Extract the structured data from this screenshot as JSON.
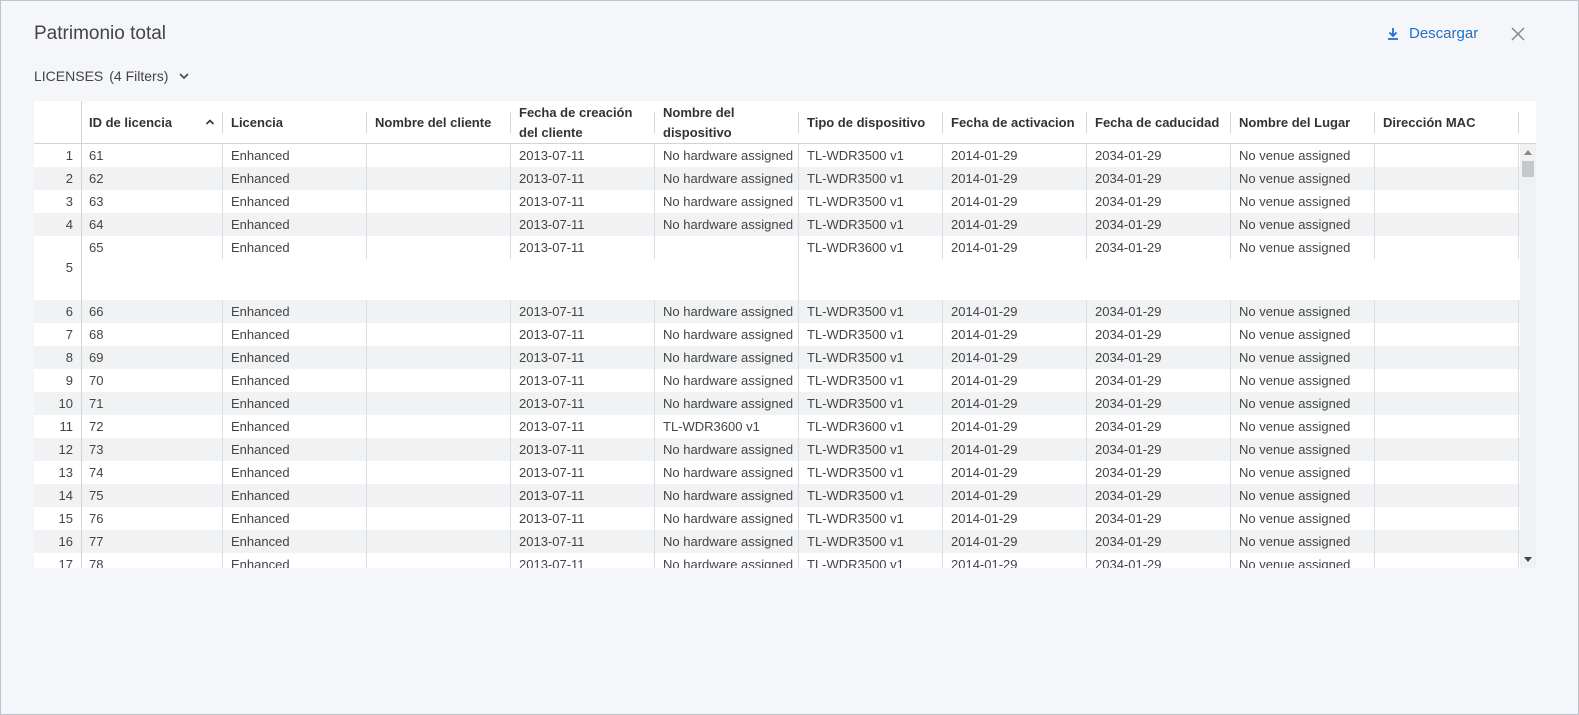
{
  "dialog": {
    "title": "Patrimonio total",
    "download_label": "Descargar"
  },
  "filter": {
    "name": "LICENSES",
    "count_label": "(4 Filters)"
  },
  "columns": [
    {
      "key": "idx",
      "label": ""
    },
    {
      "key": "id",
      "label": "ID de licencia"
    },
    {
      "key": "lic",
      "label": "Licencia"
    },
    {
      "key": "cli",
      "label": "Nombre del cliente"
    },
    {
      "key": "fec",
      "label": "Fecha de creación del cliente"
    },
    {
      "key": "dev",
      "label": "Nombre del dispositivo"
    },
    {
      "key": "tipo",
      "label": "Tipo de dispositivo"
    },
    {
      "key": "act",
      "label": "Fecha de activacion"
    },
    {
      "key": "cad",
      "label": "Fecha de caducidad"
    },
    {
      "key": "lug",
      "label": "Nombre del Lugar"
    },
    {
      "key": "mac",
      "label": "Dirección MAC"
    }
  ],
  "rows": [
    {
      "idx": "1",
      "id": "61",
      "lic": "Enhanced",
      "cli": "",
      "fec": "2013-07-11",
      "dev": "No hardware assigned",
      "tipo": "TL-WDR3500 v1",
      "act": "2014-01-29",
      "cad": "2034-01-29",
      "lug": "No venue assigned",
      "mac": ""
    },
    {
      "idx": "2",
      "id": "62",
      "lic": "Enhanced",
      "cli": "",
      "fec": "2013-07-11",
      "dev": "No hardware assigned",
      "tipo": "TL-WDR3500 v1",
      "act": "2014-01-29",
      "cad": "2034-01-29",
      "lug": "No venue assigned",
      "mac": ""
    },
    {
      "idx": "3",
      "id": "63",
      "lic": "Enhanced",
      "cli": "",
      "fec": "2013-07-11",
      "dev": "No hardware assigned",
      "tipo": "TL-WDR3500 v1",
      "act": "2014-01-29",
      "cad": "2034-01-29",
      "lug": "No venue assigned",
      "mac": ""
    },
    {
      "idx": "4",
      "id": "64",
      "lic": "Enhanced",
      "cli": "",
      "fec": "2013-07-11",
      "dev": "No hardware assigned",
      "tipo": "TL-WDR3500 v1",
      "act": "2014-01-29",
      "cad": "2034-01-29",
      "lug": "No venue assigned",
      "mac": ""
    },
    {
      "idx": "5",
      "id": "65",
      "lic": "Enhanced",
      "cli": "",
      "fec": "2013-07-11",
      "dev": "",
      "tipo": "TL-WDR3600 v1",
      "act": "2014-01-29",
      "cad": "2034-01-29",
      "lug": "No venue assigned",
      "mac": "",
      "tall": true
    },
    {
      "idx": "6",
      "id": "66",
      "lic": "Enhanced",
      "cli": "",
      "fec": "2013-07-11",
      "dev": "No hardware assigned",
      "tipo": "TL-WDR3500 v1",
      "act": "2014-01-29",
      "cad": "2034-01-29",
      "lug": "No venue assigned",
      "mac": ""
    },
    {
      "idx": "7",
      "id": "68",
      "lic": "Enhanced",
      "cli": "",
      "fec": "2013-07-11",
      "dev": "No hardware assigned",
      "tipo": "TL-WDR3500 v1",
      "act": "2014-01-29",
      "cad": "2034-01-29",
      "lug": "No venue assigned",
      "mac": ""
    },
    {
      "idx": "8",
      "id": "69",
      "lic": "Enhanced",
      "cli": "",
      "fec": "2013-07-11",
      "dev": "No hardware assigned",
      "tipo": "TL-WDR3500 v1",
      "act": "2014-01-29",
      "cad": "2034-01-29",
      "lug": "No venue assigned",
      "mac": ""
    },
    {
      "idx": "9",
      "id": "70",
      "lic": "Enhanced",
      "cli": "",
      "fec": "2013-07-11",
      "dev": "No hardware assigned",
      "tipo": "TL-WDR3500 v1",
      "act": "2014-01-29",
      "cad": "2034-01-29",
      "lug": "No venue assigned",
      "mac": ""
    },
    {
      "idx": "10",
      "id": "71",
      "lic": "Enhanced",
      "cli": "",
      "fec": "2013-07-11",
      "dev": "No hardware assigned",
      "tipo": "TL-WDR3500 v1",
      "act": "2014-01-29",
      "cad": "2034-01-29",
      "lug": "No venue assigned",
      "mac": ""
    },
    {
      "idx": "11",
      "id": "72",
      "lic": "Enhanced",
      "cli": "",
      "fec": "2013-07-11",
      "dev": "TL-WDR3600 v1",
      "tipo": "TL-WDR3600 v1",
      "act": "2014-01-29",
      "cad": "2034-01-29",
      "lug": "No venue assigned",
      "mac": ""
    },
    {
      "idx": "12",
      "id": "73",
      "lic": "Enhanced",
      "cli": "",
      "fec": "2013-07-11",
      "dev": "No hardware assigned",
      "tipo": "TL-WDR3500 v1",
      "act": "2014-01-29",
      "cad": "2034-01-29",
      "lug": "No venue assigned",
      "mac": ""
    },
    {
      "idx": "13",
      "id": "74",
      "lic": "Enhanced",
      "cli": "",
      "fec": "2013-07-11",
      "dev": "No hardware assigned",
      "tipo": "TL-WDR3500 v1",
      "act": "2014-01-29",
      "cad": "2034-01-29",
      "lug": "No venue assigned",
      "mac": ""
    },
    {
      "idx": "14",
      "id": "75",
      "lic": "Enhanced",
      "cli": "",
      "fec": "2013-07-11",
      "dev": "No hardware assigned",
      "tipo": "TL-WDR3500 v1",
      "act": "2014-01-29",
      "cad": "2034-01-29",
      "lug": "No venue assigned",
      "mac": ""
    },
    {
      "idx": "15",
      "id": "76",
      "lic": "Enhanced",
      "cli": "",
      "fec": "2013-07-11",
      "dev": "No hardware assigned",
      "tipo": "TL-WDR3500 v1",
      "act": "2014-01-29",
      "cad": "2034-01-29",
      "lug": "No venue assigned",
      "mac": ""
    },
    {
      "idx": "16",
      "id": "77",
      "lic": "Enhanced",
      "cli": "",
      "fec": "2013-07-11",
      "dev": "No hardware assigned",
      "tipo": "TL-WDR3500 v1",
      "act": "2014-01-29",
      "cad": "2034-01-29",
      "lug": "No venue assigned",
      "mac": ""
    },
    {
      "idx": "17",
      "id": "78",
      "lic": "Enhanced",
      "cli": "",
      "fec": "2013-07-11",
      "dev": "No hardware assigned",
      "tipo": "TL-WDR3500 v1",
      "act": "2014-01-29",
      "cad": "2034-01-29",
      "lug": "No venue assigned",
      "mac": ""
    }
  ],
  "colors": {
    "accent": "#1f6fd1",
    "row_alt": "#f0f2f4",
    "background": "#f4f6f9"
  },
  "icons": {
    "download": "download-icon",
    "close": "close-icon",
    "filter_toggle": "chevron-down-icon",
    "sort": "sort-ascending-icon"
  }
}
